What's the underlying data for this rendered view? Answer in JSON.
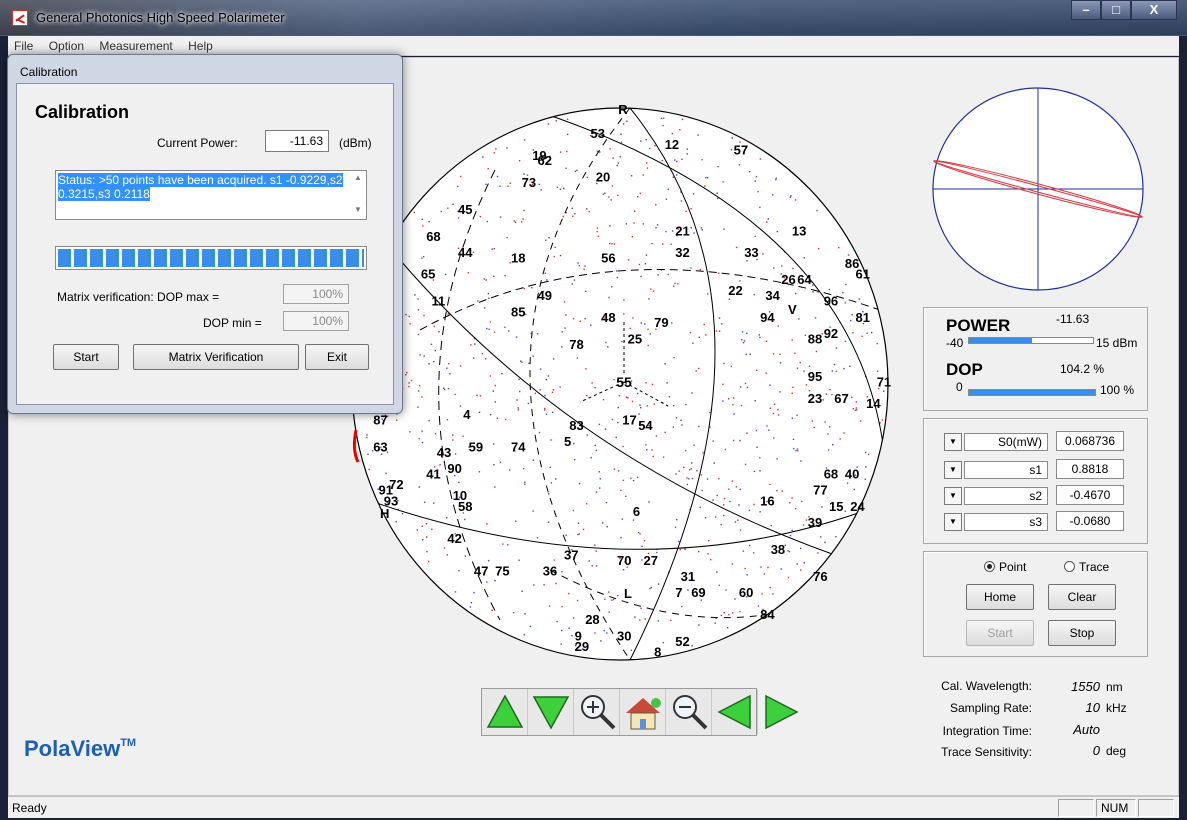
{
  "window": {
    "title": "General Photonics High Speed Polarimeter",
    "controls": {
      "minimize": "–",
      "maximize": "□",
      "close": "X"
    }
  },
  "menu": [
    "File",
    "Option",
    "Measurement",
    "Help"
  ],
  "sphere": {
    "pole_top": "R",
    "pole_bottom": "L",
    "marker_v": "V",
    "marker_h": "H",
    "center_label": "55",
    "points": [
      {
        "n": "53",
        "x": 0.45,
        "y": 0.03
      },
      {
        "n": "12",
        "x": 0.59,
        "y": 0.05
      },
      {
        "n": "57",
        "x": 0.72,
        "y": 0.06
      },
      {
        "n": "19",
        "x": 0.34,
        "y": 0.07
      },
      {
        "n": "62",
        "x": 0.35,
        "y": 0.08
      },
      {
        "n": "20",
        "x": 0.46,
        "y": 0.11
      },
      {
        "n": "73",
        "x": 0.32,
        "y": 0.12
      },
      {
        "n": "45",
        "x": 0.2,
        "y": 0.17
      },
      {
        "n": "68",
        "x": 0.14,
        "y": 0.22
      },
      {
        "n": "21",
        "x": 0.61,
        "y": 0.21
      },
      {
        "n": "13",
        "x": 0.83,
        "y": 0.21
      },
      {
        "n": "44",
        "x": 0.2,
        "y": 0.25
      },
      {
        "n": "18",
        "x": 0.3,
        "y": 0.26
      },
      {
        "n": "56",
        "x": 0.47,
        "y": 0.26
      },
      {
        "n": "32",
        "x": 0.61,
        "y": 0.25
      },
      {
        "n": "33",
        "x": 0.74,
        "y": 0.25
      },
      {
        "n": "86",
        "x": 0.93,
        "y": 0.27
      },
      {
        "n": "65",
        "x": 0.13,
        "y": 0.29
      },
      {
        "n": "26",
        "x": 0.81,
        "y": 0.3
      },
      {
        "n": "64",
        "x": 0.84,
        "y": 0.3
      },
      {
        "n": "61",
        "x": 0.95,
        "y": 0.29
      },
      {
        "n": "49",
        "x": 0.35,
        "y": 0.33
      },
      {
        "n": "22",
        "x": 0.71,
        "y": 0.32
      },
      {
        "n": "34",
        "x": 0.78,
        "y": 0.33
      },
      {
        "n": "96",
        "x": 0.89,
        "y": 0.34
      },
      {
        "n": "11",
        "x": 0.15,
        "y": 0.34
      },
      {
        "n": "85",
        "x": 0.3,
        "y": 0.36
      },
      {
        "n": "94",
        "x": 0.77,
        "y": 0.37
      },
      {
        "n": "48",
        "x": 0.47,
        "y": 0.37
      },
      {
        "n": "79",
        "x": 0.57,
        "y": 0.38
      },
      {
        "n": "81",
        "x": 0.95,
        "y": 0.37
      },
      {
        "n": "88",
        "x": 0.86,
        "y": 0.41
      },
      {
        "n": "92",
        "x": 0.89,
        "y": 0.4
      },
      {
        "n": "25",
        "x": 0.52,
        "y": 0.41
      },
      {
        "n": "78",
        "x": 0.41,
        "y": 0.42
      },
      {
        "n": "95",
        "x": 0.86,
        "y": 0.48
      },
      {
        "n": "71",
        "x": 0.99,
        "y": 0.49
      },
      {
        "n": "23",
        "x": 0.86,
        "y": 0.52
      },
      {
        "n": "67",
        "x": 0.91,
        "y": 0.52
      },
      {
        "n": "14",
        "x": 0.97,
        "y": 0.53
      },
      {
        "n": "4",
        "x": 0.21,
        "y": 0.55
      },
      {
        "n": "83",
        "x": 0.41,
        "y": 0.57
      },
      {
        "n": "17",
        "x": 0.51,
        "y": 0.56
      },
      {
        "n": "54",
        "x": 0.54,
        "y": 0.57
      },
      {
        "n": "87",
        "x": 0.04,
        "y": 0.56
      },
      {
        "n": "63",
        "x": 0.04,
        "y": 0.61
      },
      {
        "n": "43",
        "x": 0.16,
        "y": 0.62
      },
      {
        "n": "59",
        "x": 0.22,
        "y": 0.61
      },
      {
        "n": "74",
        "x": 0.3,
        "y": 0.61
      },
      {
        "n": "5",
        "x": 0.4,
        "y": 0.6
      },
      {
        "n": "41",
        "x": 0.14,
        "y": 0.66
      },
      {
        "n": "90",
        "x": 0.18,
        "y": 0.65
      },
      {
        "n": "68",
        "x": 0.89,
        "y": 0.66
      },
      {
        "n": "40",
        "x": 0.93,
        "y": 0.66
      },
      {
        "n": "72",
        "x": 0.07,
        "y": 0.68
      },
      {
        "n": "77",
        "x": 0.87,
        "y": 0.69
      },
      {
        "n": "91",
        "x": 0.05,
        "y": 0.69
      },
      {
        "n": "93",
        "x": 0.06,
        "y": 0.71
      },
      {
        "n": "10",
        "x": 0.19,
        "y": 0.7
      },
      {
        "n": "58",
        "x": 0.2,
        "y": 0.72
      },
      {
        "n": "16",
        "x": 0.77,
        "y": 0.71
      },
      {
        "n": "15",
        "x": 0.9,
        "y": 0.72
      },
      {
        "n": "24",
        "x": 0.94,
        "y": 0.72
      },
      {
        "n": "6",
        "x": 0.53,
        "y": 0.73
      },
      {
        "n": "39",
        "x": 0.86,
        "y": 0.75
      },
      {
        "n": "42",
        "x": 0.18,
        "y": 0.78
      },
      {
        "n": "38",
        "x": 0.79,
        "y": 0.8
      },
      {
        "n": "37",
        "x": 0.4,
        "y": 0.81
      },
      {
        "n": "70",
        "x": 0.5,
        "y": 0.82
      },
      {
        "n": "27",
        "x": 0.55,
        "y": 0.82
      },
      {
        "n": "47",
        "x": 0.23,
        "y": 0.84
      },
      {
        "n": "75",
        "x": 0.27,
        "y": 0.84
      },
      {
        "n": "36",
        "x": 0.36,
        "y": 0.84
      },
      {
        "n": "31",
        "x": 0.62,
        "y": 0.85
      },
      {
        "n": "76",
        "x": 0.87,
        "y": 0.85
      },
      {
        "n": "7",
        "x": 0.61,
        "y": 0.88
      },
      {
        "n": "69",
        "x": 0.64,
        "y": 0.88
      },
      {
        "n": "60",
        "x": 0.73,
        "y": 0.88
      },
      {
        "n": "84",
        "x": 0.77,
        "y": 0.92
      },
      {
        "n": "28",
        "x": 0.44,
        "y": 0.93
      },
      {
        "n": "9",
        "x": 0.42,
        "y": 0.96
      },
      {
        "n": "30",
        "x": 0.5,
        "y": 0.96
      },
      {
        "n": "52",
        "x": 0.61,
        "y": 0.97
      },
      {
        "n": "29",
        "x": 0.42,
        "y": 0.98
      },
      {
        "n": "8",
        "x": 0.57,
        "y": 0.99
      }
    ]
  },
  "power": {
    "label": "POWER",
    "value": "-11.63",
    "min": "-40",
    "max": "15 dBm",
    "fill": 0.51
  },
  "dop": {
    "label": "DOP",
    "value": "104.2 %",
    "min": "0",
    "max": "100 %",
    "fill": 1.0
  },
  "stokes": [
    {
      "label": "S0(mW)",
      "value": "0.068736"
    },
    {
      "label": "s1",
      "value": "0.8818"
    },
    {
      "label": "s2",
      "value": "-0.4670"
    },
    {
      "label": "s3",
      "value": "-0.0680"
    }
  ],
  "mode": {
    "point": "Point",
    "trace": "Trace",
    "selected": "point"
  },
  "controls": {
    "home": "Home",
    "clear": "Clear",
    "start": "Start",
    "stop": "Stop"
  },
  "info": [
    {
      "label": "Cal. Wavelength:",
      "value": "1550",
      "unit": "nm"
    },
    {
      "label": "Sampling Rate:",
      "value": "10",
      "unit": "kHz"
    },
    {
      "label": "Integration Time:",
      "value": "Auto",
      "unit": ""
    },
    {
      "label": "Trace Sensitivity:",
      "value": "0",
      "unit": "deg"
    }
  ],
  "brand": {
    "name": "PolaView",
    "tm": "TM"
  },
  "statusbar": {
    "text": "Ready",
    "num": "NUM"
  },
  "calibration": {
    "window_title": "Calibration",
    "heading": "Calibration",
    "current_power_label": "Current Power:",
    "current_power_value": "-11.63",
    "current_power_unit": "(dBm)",
    "status_text": "Status: >50 points have been acquired. s1 -0.9229,s2 0.3215,s3 0.2118",
    "progress": 1.0,
    "dop_max_label": "Matrix verification: DOP max =",
    "dop_max_value": "100%",
    "dop_min_label": "DOP min =",
    "dop_min_value": "100%",
    "buttons": {
      "start": "Start",
      "verify": "Matrix Verification",
      "exit": "Exit"
    }
  }
}
